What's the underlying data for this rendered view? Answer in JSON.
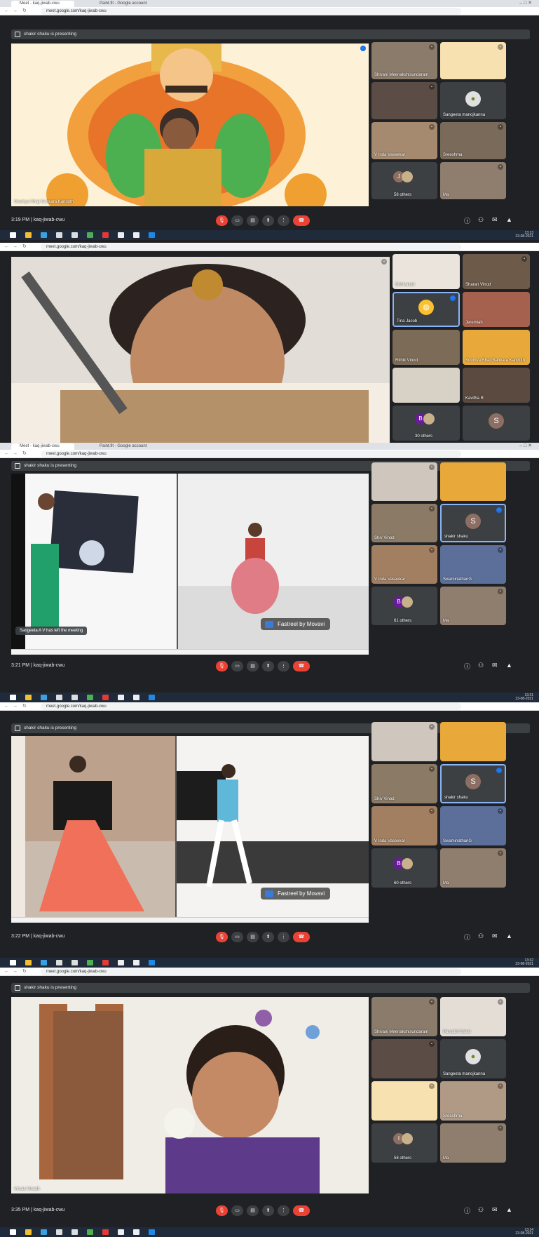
{
  "browser": {
    "tab1_title": "Meet - kaq-jiwab-cwu",
    "tab2_title": "Paint.fit - Google account",
    "url": "meet.google.com/kaq-jiwab-cwu",
    "win_controls": "–  □  ✕"
  },
  "shot1": {
    "presenting": "shakir shaku is presenting",
    "main_caption": "Soumya Shaji Sankara Kandoth",
    "tiles": [
      {
        "name": "Shivani Meenakshisundaram"
      },
      {
        "name": ""
      },
      {
        "name": "Sangeeta manojkanna"
      },
      {
        "name": "V Inda Vaseekar"
      },
      {
        "name": "Sreeshma"
      },
      {
        "name": "58 others"
      },
      {
        "name": "Ma"
      }
    ],
    "time": "3:19 PM",
    "meeting_code": "kaq-jiwab-cwu",
    "clock": "13:13",
    "date": "23-08-2021"
  },
  "shot2": {
    "tiles": [
      {
        "name": "Srinivasan"
      },
      {
        "name": "Sharan Vinod"
      },
      {
        "name": "Tina Jacob"
      },
      {
        "name": "Jeremiah"
      },
      {
        "name": "Rithik Vinod"
      },
      {
        "name": "Soumya Shaji Sankara Kandoth"
      },
      {
        "name": ""
      },
      {
        "name": "Kavitha R"
      },
      {
        "name": "30 others"
      },
      {
        "name": "S"
      }
    ]
  },
  "shot3": {
    "presenting": "shakir shaku is presenting",
    "toast": "Sangeeta A V has left the meeting",
    "watermark": "Fastreel by Movavi",
    "tiles": [
      {
        "name": ""
      },
      {
        "name": ""
      },
      {
        "name": "Shiv Vinod"
      },
      {
        "name": "shakir shaku"
      },
      {
        "name": "V Inda Vaseekar"
      },
      {
        "name": "SwaminathanG"
      },
      {
        "name": "61 others"
      },
      {
        "name": "Ma"
      }
    ],
    "time": "3:21 PM",
    "meeting_code": "kaq-jiwab-cwu",
    "clock": "13:31",
    "date": "23-08-2021"
  },
  "shot4": {
    "presenting": "shakir shaku is presenting",
    "watermark": "Fastreel by Movavi",
    "tiles": [
      {
        "name": ""
      },
      {
        "name": ""
      },
      {
        "name": "Shiv Vinod"
      },
      {
        "name": "shakir shaku"
      },
      {
        "name": "V Inda Vaseekar"
      },
      {
        "name": "SwaminathanG"
      },
      {
        "name": "60 others"
      },
      {
        "name": "Ma"
      }
    ],
    "time": "3:22 PM",
    "meeting_code": "kaq-jiwab-cwu",
    "clock": "13:32",
    "date": "23-08-2021"
  },
  "shot5": {
    "presenting": "shakir shaku is presenting",
    "main_caption": "Vinola Vinodh",
    "tiles": [
      {
        "name": "Shivani Meenakshisundaram"
      },
      {
        "name": "Parvathi Sahar"
      },
      {
        "name": ""
      },
      {
        "name": "Sangeeta manojkanna"
      },
      {
        "name": ""
      },
      {
        "name": "Sreeshma"
      },
      {
        "name": "58 others"
      },
      {
        "name": "Ma"
      }
    ],
    "time": "3:35 PM",
    "meeting_code": "kaq-jiwab-cwu",
    "clock": "13:14",
    "date": "23-08-2021"
  },
  "colors": {
    "bg": "#202124",
    "tile": "#3c4043",
    "end_call": "#ea4335",
    "accent": "#1a73e8"
  },
  "icons": [
    "mic-off-icon",
    "camera-icon",
    "captions-icon",
    "present-icon",
    "more-icon",
    "end-call-icon",
    "info-icon",
    "people-icon",
    "chat-icon",
    "activities-icon"
  ]
}
